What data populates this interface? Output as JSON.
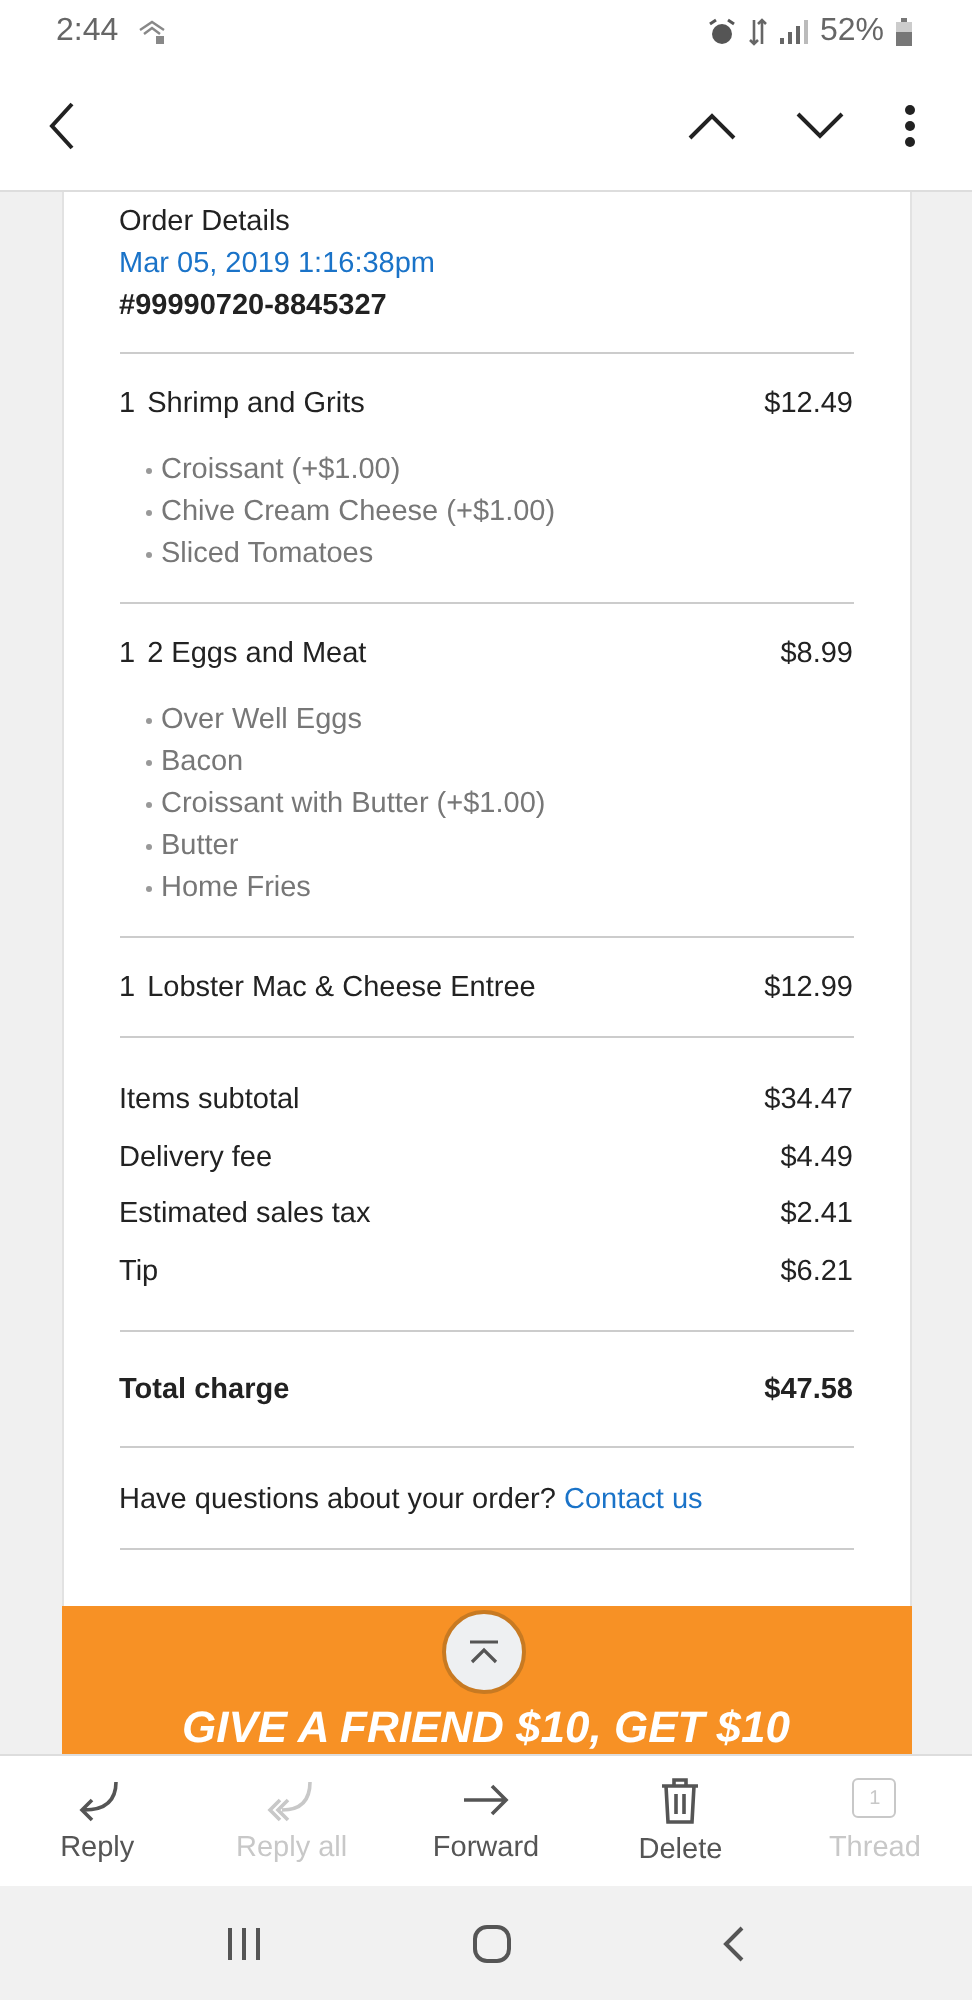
{
  "status_bar": {
    "time": "2:44",
    "battery": "52%"
  },
  "order": {
    "heading": "Order Details",
    "date": "Mar 05, 2019 1:16:38pm",
    "number": "#99990720-8845327",
    "items": [
      {
        "qty": "1",
        "name": "Shrimp and Grits",
        "price": "$12.49",
        "options": [
          "Croissant (+$1.00)",
          "Chive Cream Cheese (+$1.00)",
          "Sliced Tomatoes"
        ]
      },
      {
        "qty": "1",
        "name": "2 Eggs and Meat",
        "price": "$8.99",
        "options": [
          "Over Well Eggs",
          "Bacon",
          "Croissant with Butter (+$1.00)",
          "Butter",
          "Home Fries"
        ]
      },
      {
        "qty": "1",
        "name": "Lobster Mac & Cheese Entree",
        "price": "$12.99"
      }
    ],
    "totals": [
      {
        "label": "Items subtotal",
        "value": "$34.47"
      },
      {
        "label": "Delivery fee",
        "value": "$4.49"
      },
      {
        "label": "Estimated sales tax",
        "value": "$2.41"
      },
      {
        "label": "Tip",
        "value": "$6.21"
      }
    ],
    "total": {
      "label": "Total charge",
      "value": "$47.58"
    },
    "questions": {
      "text": "Have questions about your order?",
      "link": "Contact us"
    }
  },
  "banner": {
    "text": "GIVE A FRIEND $10, GET $10"
  },
  "toolbar": [
    {
      "kind": "reply",
      "label": "Reply",
      "disabled": false
    },
    {
      "kind": "reply_all",
      "label": "Reply all",
      "disabled": true
    },
    {
      "kind": "forward",
      "label": "Forward",
      "disabled": false
    },
    {
      "kind": "delete",
      "label": "Delete",
      "disabled": false
    },
    {
      "kind": "thread",
      "label": "Thread",
      "count": "1",
      "disabled": true
    }
  ]
}
